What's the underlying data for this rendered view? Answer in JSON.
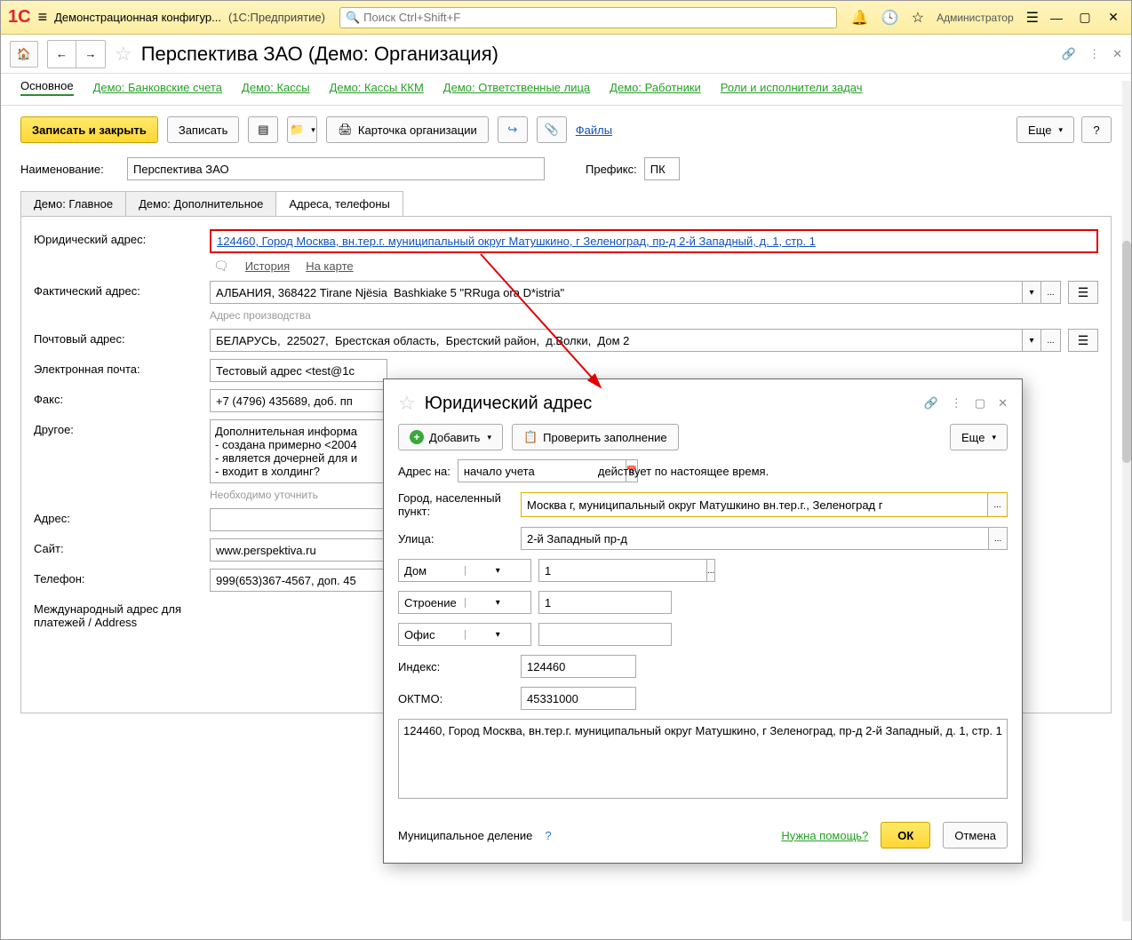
{
  "titlebar": {
    "config_name": "Демонстрационная конфигур...",
    "product": "(1С:Предприятие)",
    "search_placeholder": "Поиск Ctrl+Shift+F",
    "user": "Администратор"
  },
  "page": {
    "title": "Перспектива ЗАО (Демо: Организация)"
  },
  "navlinks": {
    "main": "Основное",
    "l1": "Демо: Банковские счета",
    "l2": "Демо: Кассы",
    "l3": "Демо: Кассы ККМ",
    "l4": "Демо: Ответственные лица",
    "l5": "Демо: Работники",
    "l6": "Роли и исполнители задач"
  },
  "toolbar": {
    "save_close": "Записать и закрыть",
    "save": "Записать",
    "card": "Карточка организации",
    "files": "Файлы",
    "more": "Еще"
  },
  "form": {
    "name_label": "Наименование:",
    "name_value": "Перспектива ЗАО",
    "prefix_label": "Префикс:",
    "prefix_value": "ПК"
  },
  "tabs": {
    "t1": "Демо: Главное",
    "t2": "Демо: Дополнительное",
    "t3": "Адреса, телефоны"
  },
  "content": {
    "legal_addr_label": "Юридический адрес:",
    "legal_addr_value": "124460, Город Москва, вн.тер.г. муниципальный округ Матушкино, г Зеленоград, пр-д 2-й Западный, д. 1, стр. 1",
    "history": "История",
    "on_map": "На карте",
    "actual_addr_label": "Фактический адрес:",
    "actual_addr_value": "АЛБАНИЯ, 368422 Tirane Njёsia  Bashkiake 5 \"RRuga ora D*istria\"",
    "actual_hint": "Адрес производства",
    "post_addr_label": "Почтовый адрес:",
    "post_addr_value": "БЕЛАРУСЬ,  225027,  Брестская область,  Брестский район,  д.Волки,  Дом 2",
    "email_label": "Электронная почта:",
    "email_value": "Тестовый адрес <test@1c",
    "fax_label": "Факс:",
    "fax_value": "+7 (4796) 435689, доб. пп",
    "other_label": "Другое:",
    "other_value": "Дополнительная информа\n- создана примерно <2004\n- является дочерней для и\n- входит в холдинг?",
    "other_hint": "Необходимо уточнить",
    "addr_label": "Адрес:",
    "site_label": "Сайт:",
    "site_value": "www.perspektiva.ru",
    "phone_label": "Телефон:",
    "phone_value": "999(653)367-4567, доп. 45",
    "intl_label": "Международный адрес для платежей / Address"
  },
  "popup": {
    "title": "Юридический адрес",
    "add": "Добавить",
    "check": "Проверить заполнение",
    "more": "Еще",
    "date_label": "Адрес на:",
    "date_value": "начало учета",
    "date_suffix": "действует по настоящее время.",
    "city_label": "Город, населенный пункт:",
    "city_value": "Москва г, муниципальный округ Матушкино вн.тер.г., Зеленоград г",
    "street_label": "Улица:",
    "street_value": "2-й Западный пр-д",
    "prop1_label": "Дом",
    "prop1_value": "1",
    "prop2_label": "Строение",
    "prop2_value": "1",
    "prop3_label": "Офис",
    "prop3_value": "",
    "index_label": "Индекс:",
    "index_value": "124460",
    "oktmo_label": "ОКТМО:",
    "oktmo_value": "45331000",
    "full_addr": "124460, Город Москва, вн.тер.г. муниципальный округ Матушкино, г Зеленоград, пр-д 2-й Западный, д. 1, стр. 1",
    "division": "Муниципальное деление",
    "help": "Нужна помощь?",
    "ok": "ОК",
    "cancel": "Отмена"
  }
}
